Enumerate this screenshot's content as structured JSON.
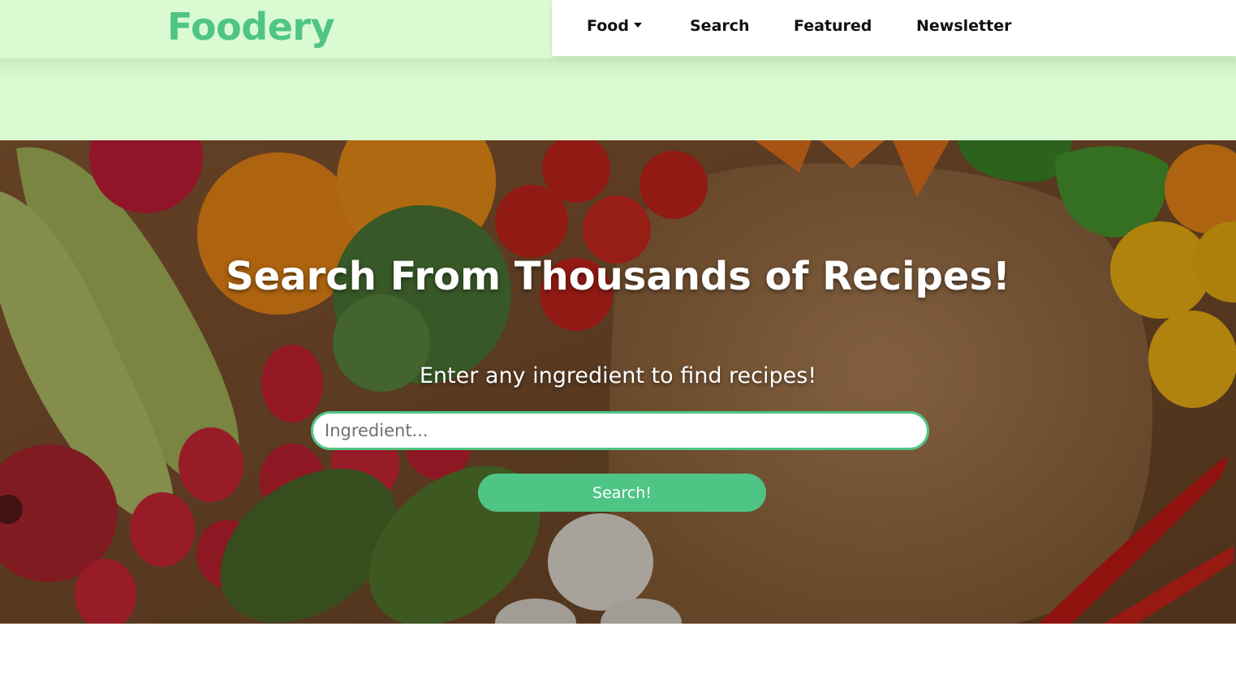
{
  "brand": {
    "name": "Foodery",
    "color": "#4fc585"
  },
  "nav": {
    "items": [
      {
        "label": "Food",
        "has_dropdown": true
      },
      {
        "label": "Search"
      },
      {
        "label": "Featured"
      },
      {
        "label": "Newsletter"
      }
    ]
  },
  "hero": {
    "title": "Search From Thousands of Recipes!",
    "subtitle": "Enter any ingredient to find recipes!",
    "search_placeholder": "Ingredient...",
    "search_value": "",
    "search_button_label": "Search!"
  },
  "colors": {
    "header_bg": "#dafbd2",
    "accent": "#4fc585",
    "nav_bg": "#ffffff"
  }
}
